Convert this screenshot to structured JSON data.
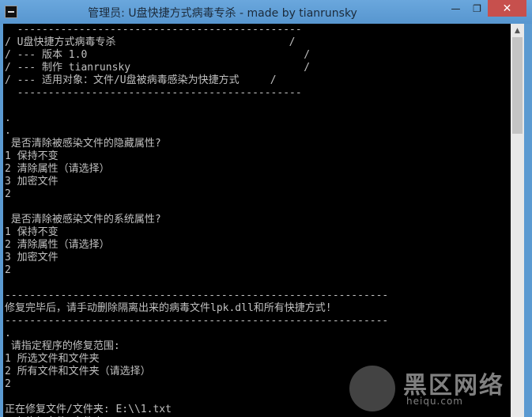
{
  "window": {
    "title": "管理员: U盘快捷方式病毒专杀 - made by tianrunsky",
    "minimize_glyph": "—",
    "maximize_glyph": "❐",
    "close_glyph": "✕",
    "icon": "console-icon"
  },
  "console": {
    "lines": [
      "  ----------------------------------------------",
      "/ U盘快捷方式病毒专杀                            /",
      "/ --- 版本 1.0                                   /",
      "/ --- 制作 tianrunsky                            /",
      "/ --- 适用对象：文件/U盘被病毒感染为快捷方式     /",
      "  ----------------------------------------------",
      "",
      ".",
      ".",
      " 是否清除被感染文件的隐藏属性?",
      "1 保持不变",
      "2 清除属性（请选择）",
      "3 加密文件",
      "2",
      "",
      " 是否清除被感染文件的系统属性?",
      "1 保持不变",
      "2 清除属性（请选择）",
      "3 加密文件",
      "2",
      "",
      "--------------------------------------------------------------",
      "修复完毕后，请手动删除隔离出来的病毒文件lpk.dll和所有快捷方式!",
      "--------------------------------------------------------------",
      ".",
      " 请指定程序的修复范围:",
      "1 所选文件和文件夹",
      "2 所有文件和文件夹（请选择）",
      "2",
      "",
      "正在修复文件/文件夹: E:\\\\1.txt",
      "正在修复文件/文件夹: E:\\\\casper"
    ]
  },
  "scrollbar": {
    "up_glyph": "▲"
  },
  "watermark": {
    "text": "黑区网络",
    "sub": "heiqu.com"
  },
  "colors": {
    "console_bg": "#000000",
    "console_fg": "#c0c0c0",
    "titlebar": "#5b9ad1",
    "close": "#c7504d"
  }
}
